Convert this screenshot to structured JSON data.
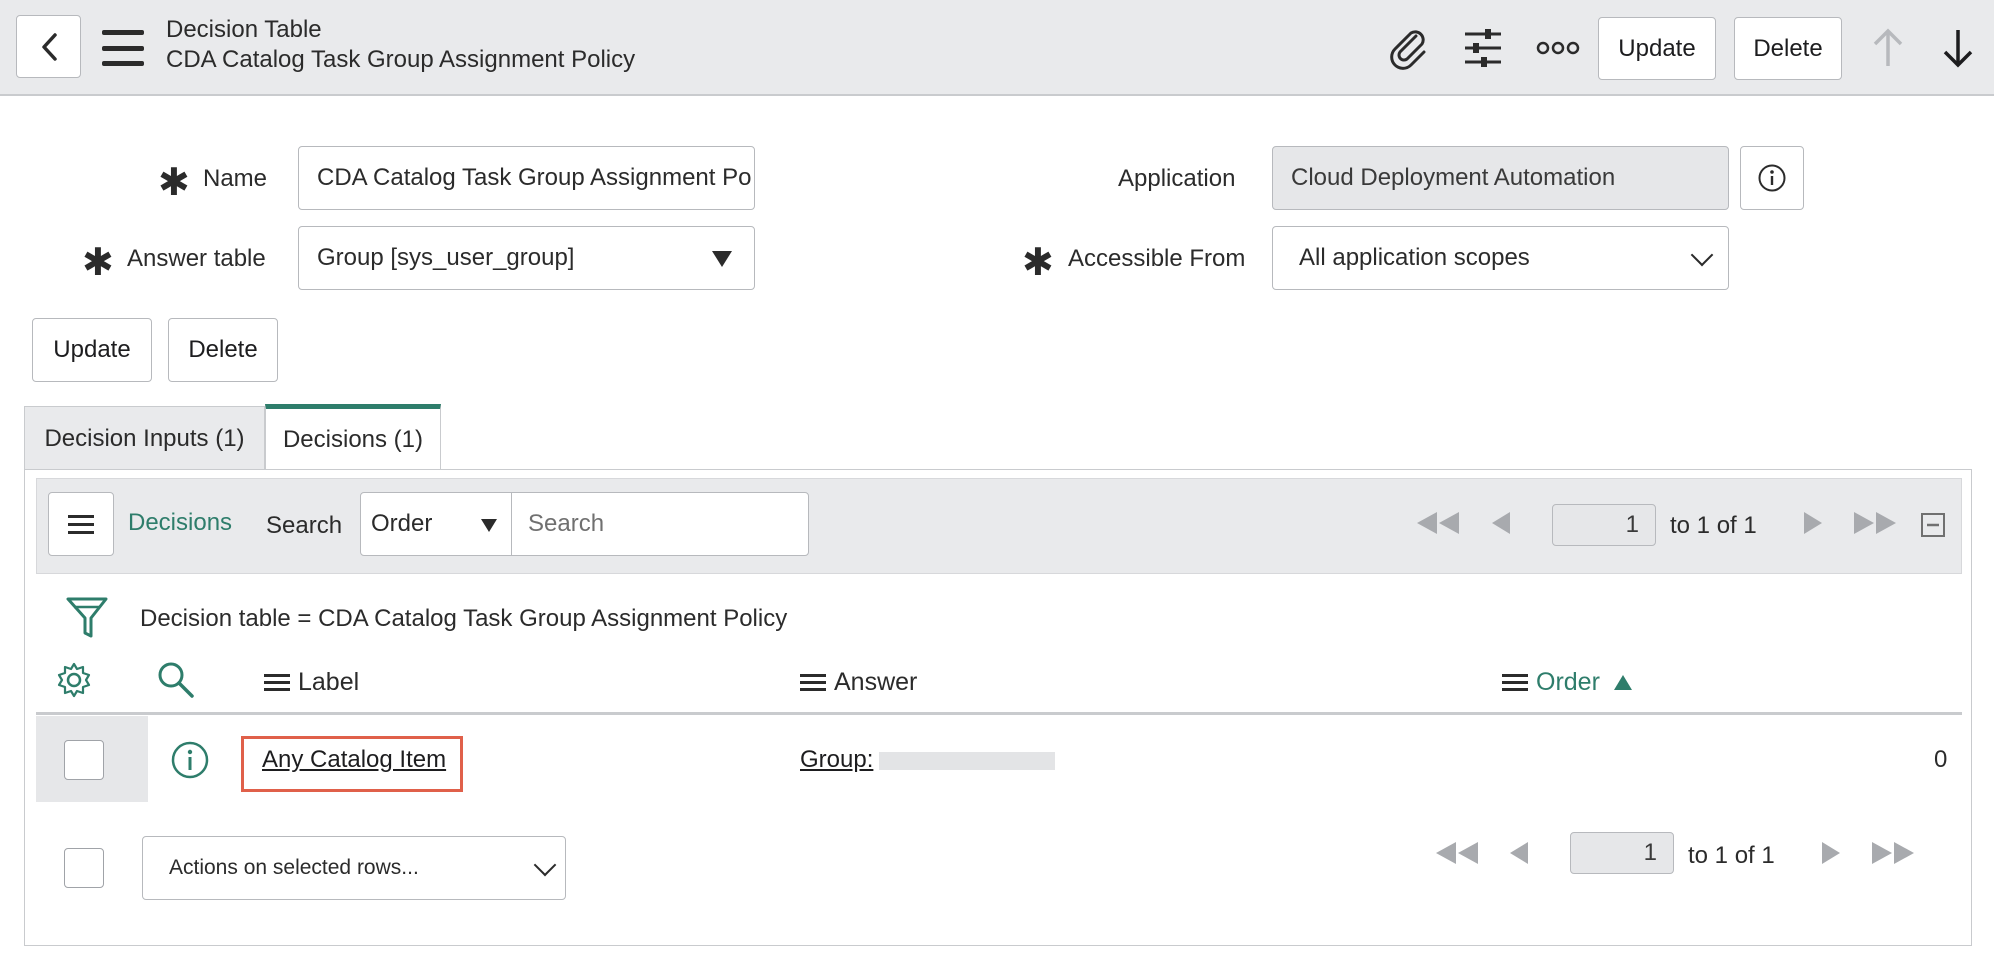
{
  "header": {
    "record_type": "Decision Table",
    "record_name": "CDA Catalog Task Group Assignment Policy",
    "update_label": "Update",
    "delete_label": "Delete",
    "icons": [
      "back-icon",
      "hamburger-icon",
      "paperclip-icon",
      "sliders-icon",
      "more-icon",
      "arrow-up-icon",
      "arrow-down-icon"
    ]
  },
  "form": {
    "name_label": "Name",
    "name_value": "CDA Catalog Task Group Assignment Po",
    "answer_table_label": "Answer table",
    "answer_table_value": "Group [sys_user_group]",
    "application_label": "Application",
    "application_value": "Cloud Deployment Automation",
    "accessible_from_label": "Accessible From",
    "accessible_from_value": "All application scopes",
    "update_label": "Update",
    "delete_label": "Delete"
  },
  "tabs": [
    {
      "label": "Decision Inputs (1)",
      "active": false
    },
    {
      "label": "Decisions (1)",
      "active": true
    }
  ],
  "list": {
    "title": "Decisions",
    "search_label": "Search",
    "search_field": "Order",
    "search_placeholder": "Search",
    "page_value": "1",
    "range_text": "to 1 of 1",
    "filter_text": "Decision table = CDA Catalog Task Group Assignment Policy",
    "columns": [
      {
        "label": "Label"
      },
      {
        "label": "Answer"
      },
      {
        "label": "Order",
        "sorted": "ascending"
      }
    ],
    "rows": [
      {
        "label": "Any Catalog Item",
        "answer": "Group:",
        "order": "0"
      }
    ],
    "actions_label": "Actions on selected rows...",
    "bottom_page_value": "1",
    "bottom_range_text": "to 1 of 1"
  },
  "colors": {
    "accent": "#2e7d6b",
    "highlight": "#e0604a",
    "header_bg": "#e9eaec"
  }
}
